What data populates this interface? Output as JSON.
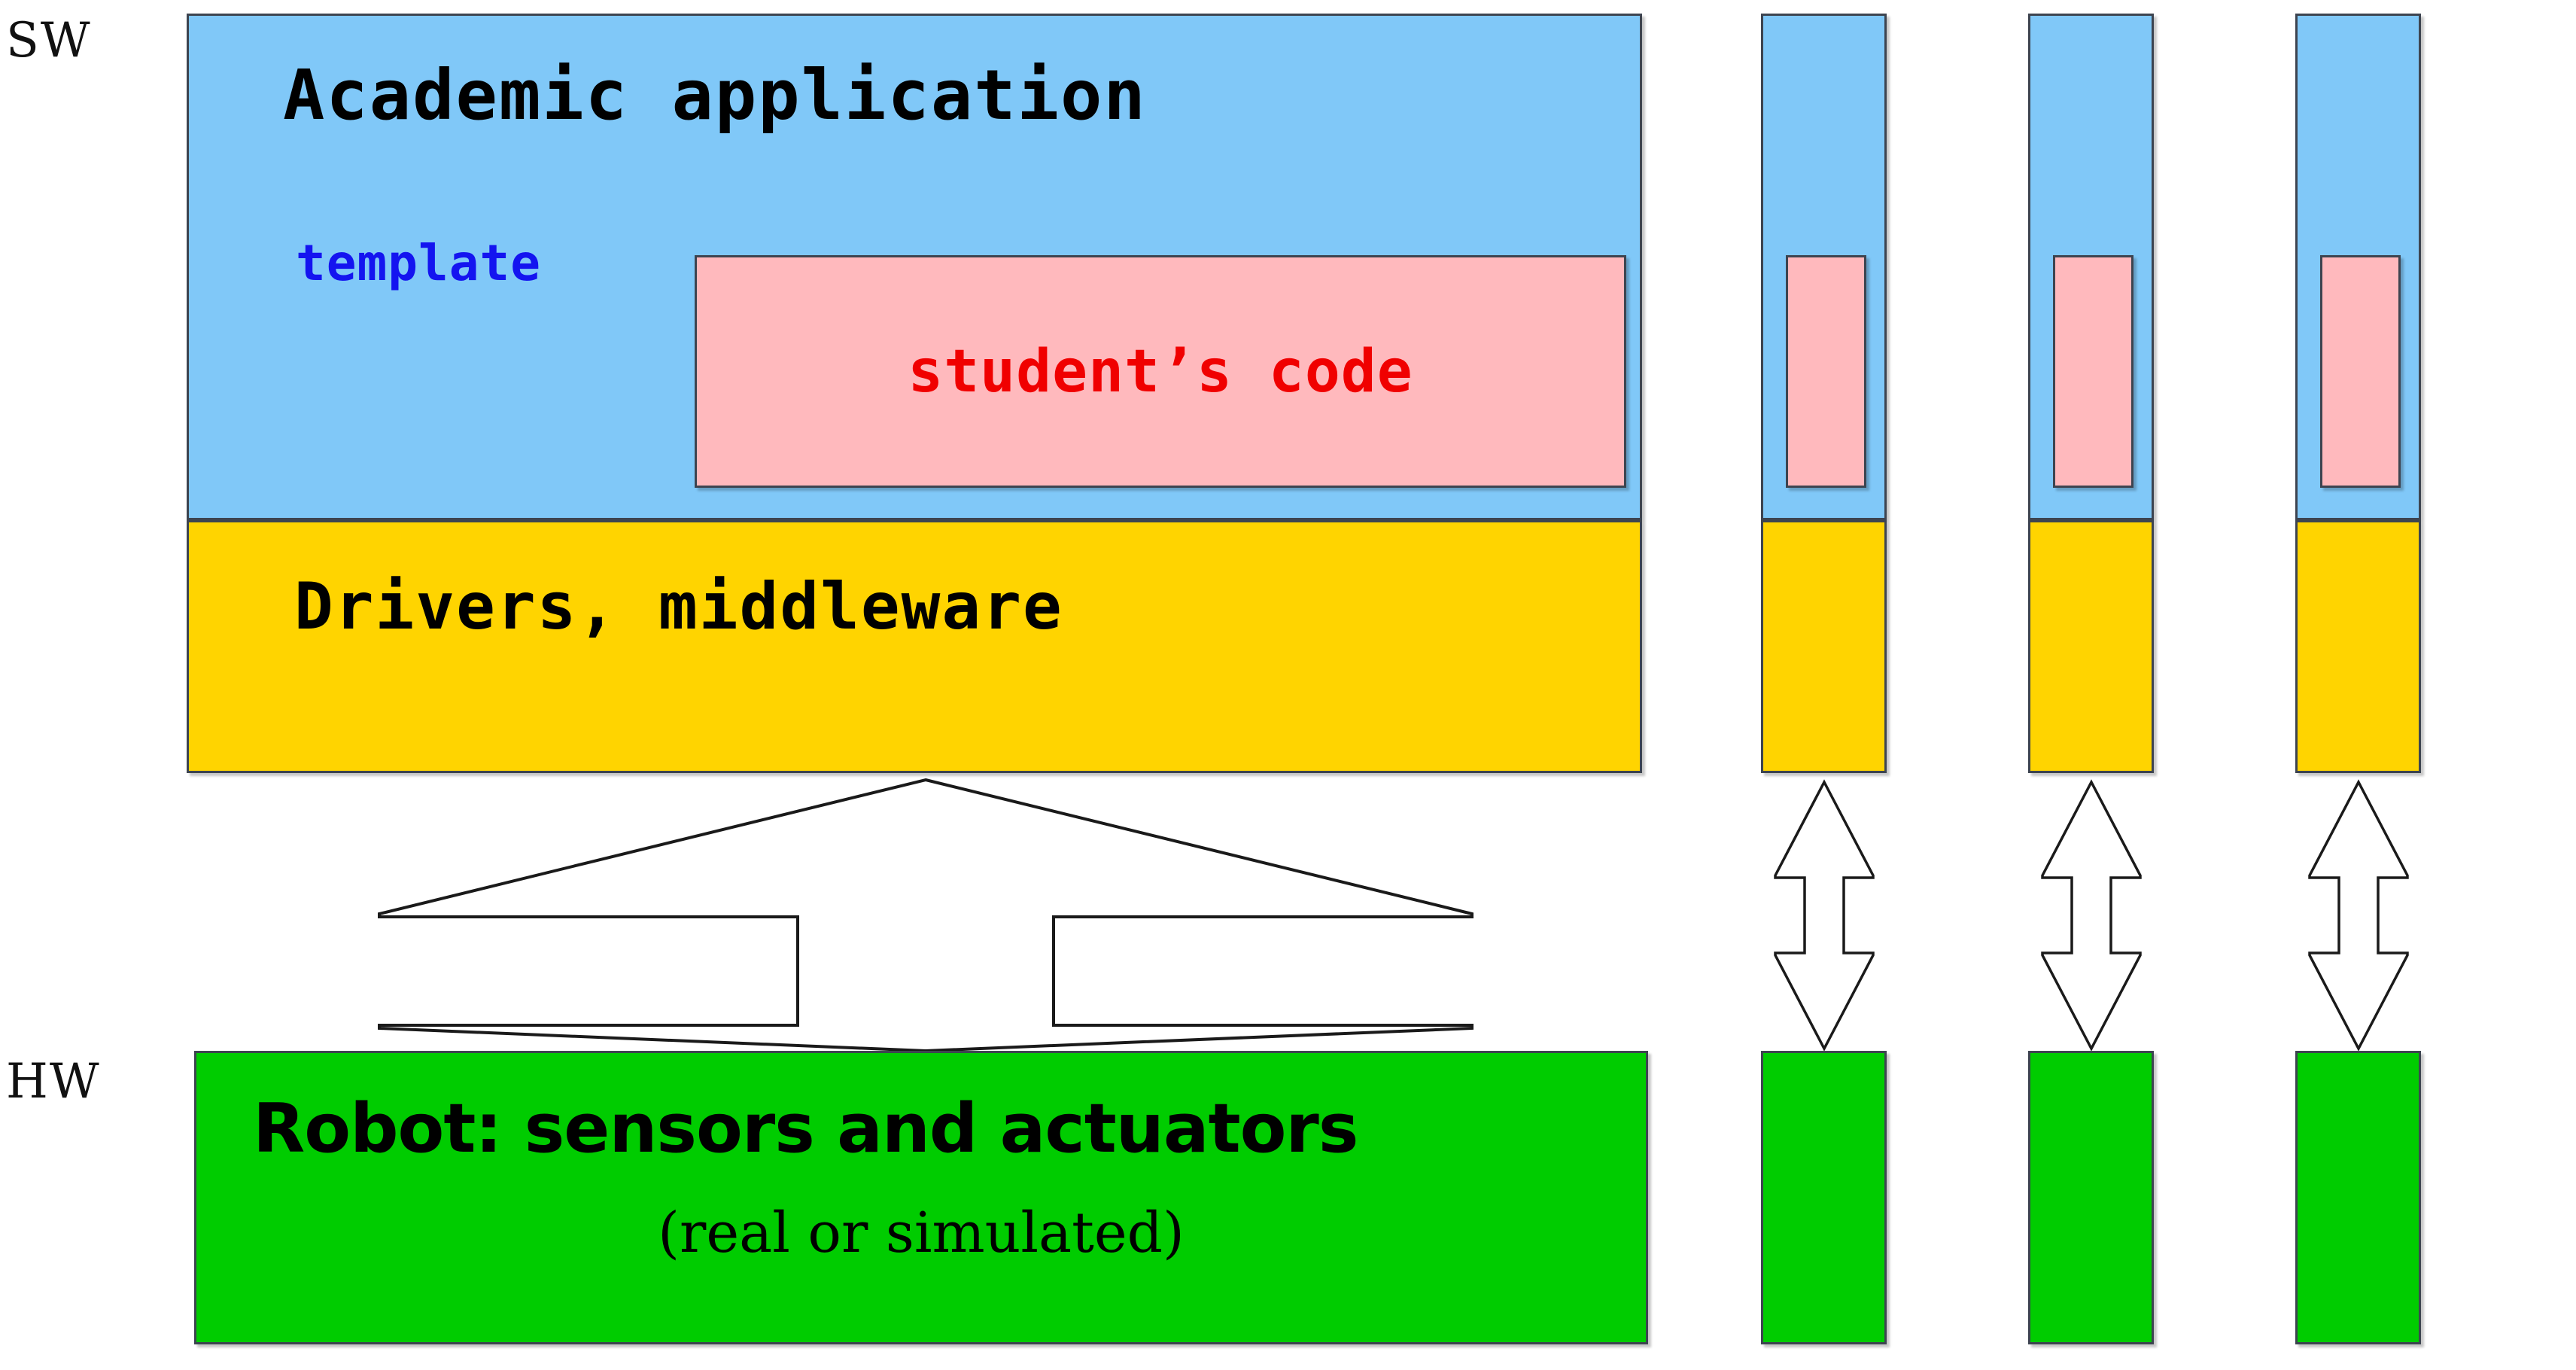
{
  "diagram": {
    "title_labels": {
      "software": "SW",
      "hardware": "HW"
    },
    "layers": {
      "application": {
        "label": "Academic application",
        "color": "#80c8f8",
        "sub_labels": {
          "template": "template",
          "template_color": "#1414f0",
          "student_code": "student’s code",
          "student_code_color": "#f00000",
          "student_code_box_color": "#ffb9bd"
        }
      },
      "middleware": {
        "label": "Drivers, middleware",
        "color": "#ffd400"
      },
      "hardware": {
        "label_line1": "Robot: sensors and actuators",
        "label_line2": "(real or simulated)",
        "color": "#00cc00"
      }
    },
    "connector": {
      "name": "double-headed-vertical-arrow",
      "direction": "up-down",
      "count_main": 1,
      "count_columns": 3
    },
    "columns": [
      {
        "id": 1,
        "application_color": "#80c8f8",
        "student_code_color": "#ffb9bd",
        "middleware_color": "#ffd400",
        "hardware_color": "#00cc00"
      },
      {
        "id": 2,
        "application_color": "#80c8f8",
        "student_code_color": "#ffb9bd",
        "middleware_color": "#ffd400",
        "hardware_color": "#00cc00"
      },
      {
        "id": 3,
        "application_color": "#80c8f8",
        "student_code_color": "#ffb9bd",
        "middleware_color": "#ffd400",
        "hardware_color": "#00cc00"
      }
    ]
  }
}
